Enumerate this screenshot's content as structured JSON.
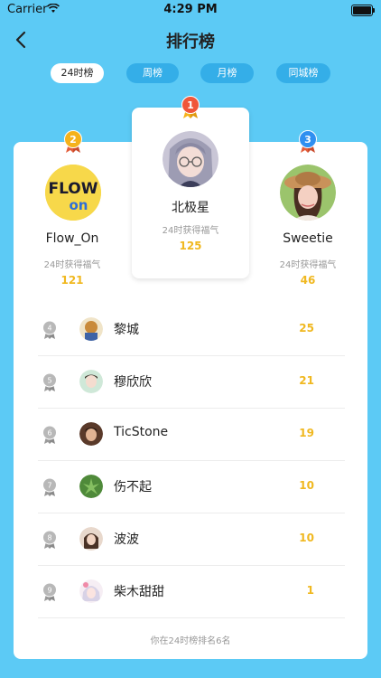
{
  "status_bar": {
    "carrier": "Carrier",
    "time": "4:29 PM"
  },
  "header": {
    "title": "排行榜"
  },
  "tabs": [
    {
      "label": "24时榜",
      "active": true
    },
    {
      "label": "周榜",
      "active": false
    },
    {
      "label": "月榜",
      "active": false
    },
    {
      "label": "同城榜",
      "active": false
    }
  ],
  "podium": {
    "caption": "24时获得福气",
    "first": {
      "rank": "1",
      "name": "北极星",
      "value": "125"
    },
    "second": {
      "rank": "2",
      "name": "Flow_On",
      "value": "121",
      "logo_line1": "FLOW",
      "logo_line2": "on"
    },
    "third": {
      "rank": "3",
      "name": "Sweetie",
      "value": "46"
    }
  },
  "list": [
    {
      "rank": "4",
      "name": "黎城",
      "value": "25"
    },
    {
      "rank": "5",
      "name": "穆欣欣",
      "value": "21"
    },
    {
      "rank": "6",
      "name": "TicStone",
      "value": "19"
    },
    {
      "rank": "7",
      "name": "伤不起",
      "value": "10"
    },
    {
      "rank": "8",
      "name": "波波",
      "value": "10"
    },
    {
      "rank": "9",
      "name": "柴木甜甜",
      "value": "1"
    }
  ],
  "footer": {
    "note": "你在24时榜排名6名"
  },
  "colors": {
    "background": "#5ccaf5",
    "tab_inactive": "#34aee8",
    "gold": "#f0b820",
    "medal_red": "#f0563a",
    "medal_blue": "#2f8ff0",
    "medal_gold": "#f5b21b"
  }
}
